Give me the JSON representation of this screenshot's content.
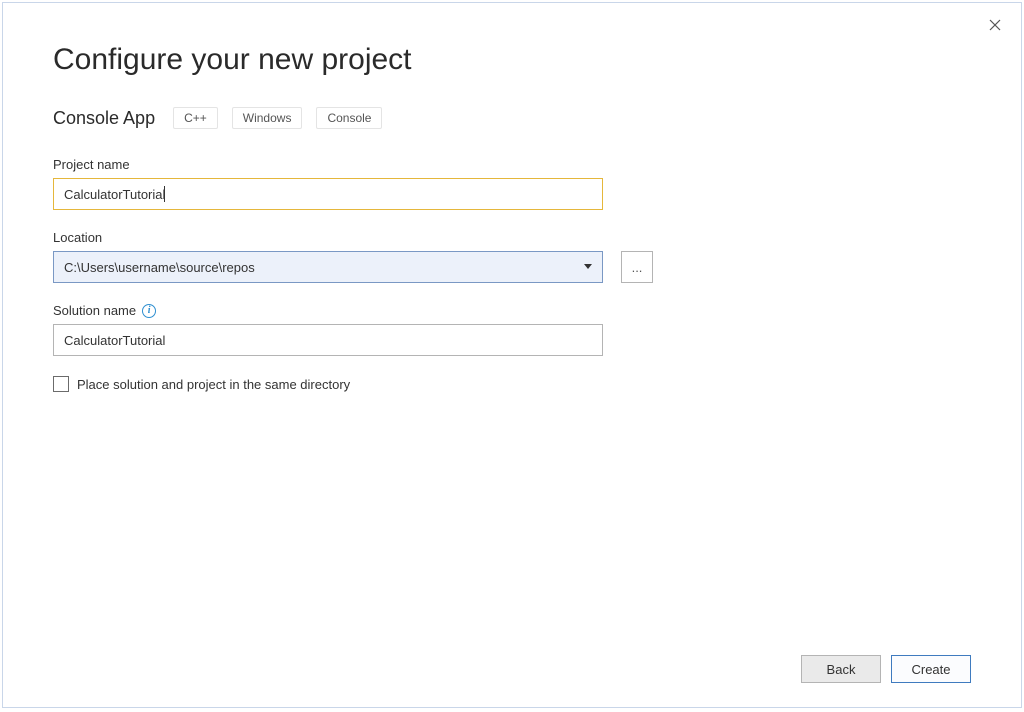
{
  "dialog": {
    "title": "Configure your new project",
    "template_name": "Console App",
    "tags": [
      "C++",
      "Windows",
      "Console"
    ]
  },
  "fields": {
    "project_name": {
      "label": "Project name",
      "value": "CalculatorTutorial"
    },
    "location": {
      "label": "Location",
      "value": "C:\\Users\\username\\source\\repos",
      "browse_label": "..."
    },
    "solution_name": {
      "label": "Solution name",
      "value": "CalculatorTutorial"
    },
    "same_directory": {
      "label": "Place solution and project in the same directory",
      "checked": false
    }
  },
  "buttons": {
    "back": "Back",
    "create": "Create"
  }
}
